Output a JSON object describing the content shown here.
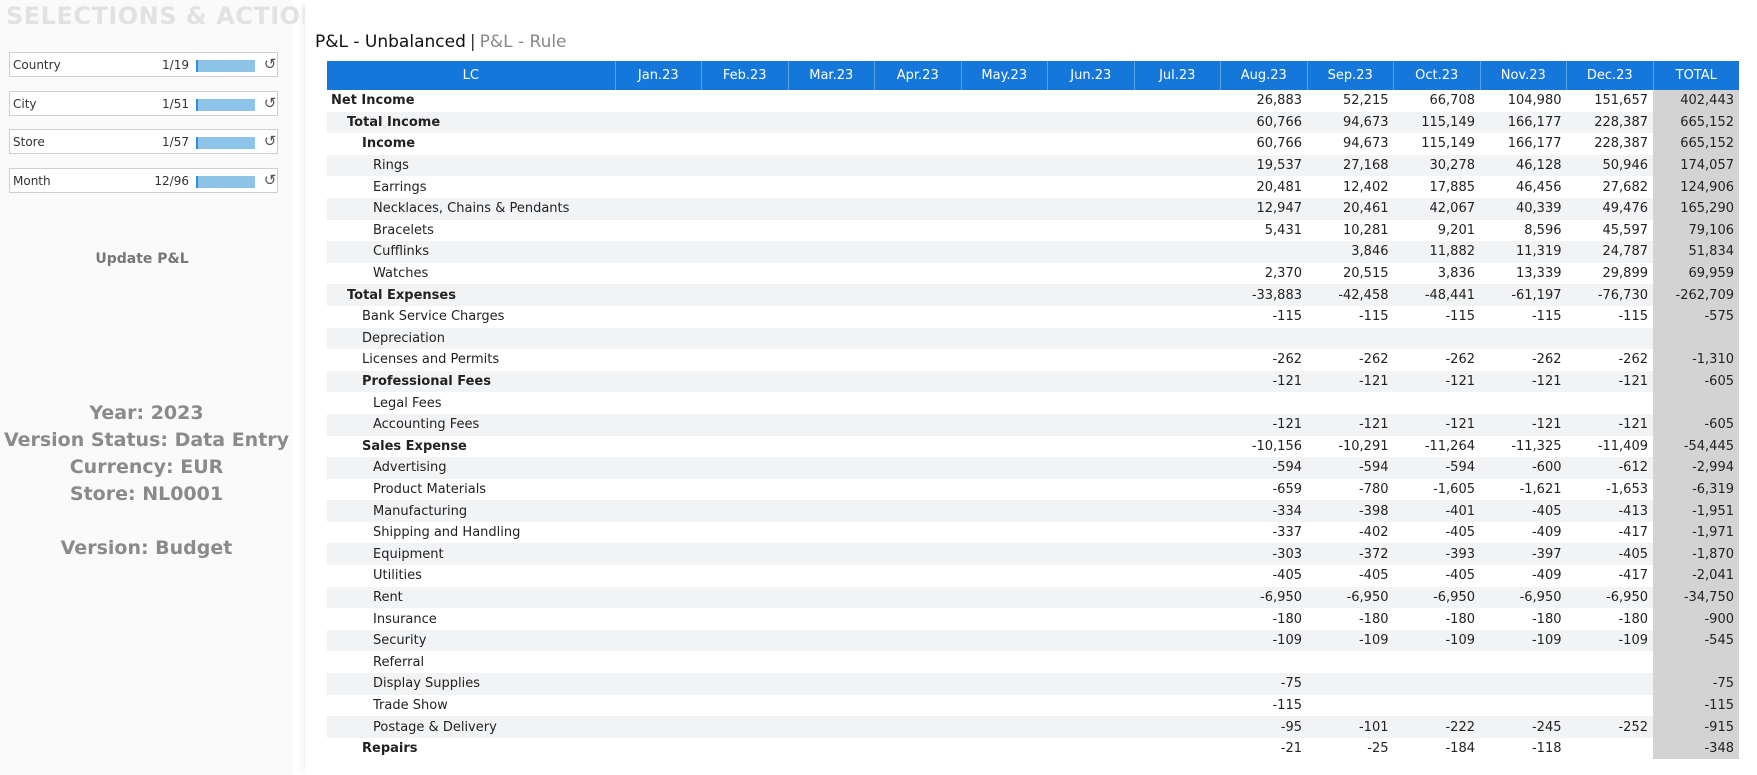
{
  "left": {
    "title": "SELECTIONS & ACTIONS",
    "selectors": [
      {
        "label": "Country",
        "count": "1/19"
      },
      {
        "label": "City",
        "count": "1/51"
      },
      {
        "label": "Store",
        "count": "1/57"
      },
      {
        "label": "Month",
        "count": "12/96"
      }
    ],
    "update_label": "Update P&L",
    "info": {
      "year": "Year: 2023",
      "version_status": "Version Status: Data Entry",
      "currency": "Currency: EUR",
      "store": "Store: NL0001",
      "version": "Version: Budget"
    }
  },
  "report": {
    "title_main": "P&L - Unbalanced",
    "title_sep": "|",
    "title_sub": "P&L - Rule",
    "columns": [
      "LC",
      "Jan.23",
      "Feb.23",
      "Mar.23",
      "Apr.23",
      "May.23",
      "Jun.23",
      "Jul.23",
      "Aug.23",
      "Sep.23",
      "Oct.23",
      "Nov.23",
      "Dec.23",
      "TOTAL"
    ],
    "rows": [
      {
        "label": "Net Income",
        "level": 0,
        "bold": true,
        "values": [
          "",
          "",
          "",
          "",
          "",
          "",
          "",
          "26,883",
          "52,215",
          "66,708",
          "104,980",
          "151,657",
          "402,443"
        ]
      },
      {
        "label": "Total Income",
        "level": 1,
        "bold": true,
        "values": [
          "",
          "",
          "",
          "",
          "",
          "",
          "",
          "60,766",
          "94,673",
          "115,149",
          "166,177",
          "228,387",
          "665,152"
        ]
      },
      {
        "label": "Income",
        "level": 2,
        "bold": true,
        "values": [
          "",
          "",
          "",
          "",
          "",
          "",
          "",
          "60,766",
          "94,673",
          "115,149",
          "166,177",
          "228,387",
          "665,152"
        ]
      },
      {
        "label": "Rings",
        "level": 3,
        "bold": false,
        "values": [
          "",
          "",
          "",
          "",
          "",
          "",
          "",
          "19,537",
          "27,168",
          "30,278",
          "46,128",
          "50,946",
          "174,057"
        ]
      },
      {
        "label": "Earrings",
        "level": 3,
        "bold": false,
        "values": [
          "",
          "",
          "",
          "",
          "",
          "",
          "",
          "20,481",
          "12,402",
          "17,885",
          "46,456",
          "27,682",
          "124,906"
        ]
      },
      {
        "label": "Necklaces, Chains & Pendants",
        "level": 3,
        "bold": false,
        "values": [
          "",
          "",
          "",
          "",
          "",
          "",
          "",
          "12,947",
          "20,461",
          "42,067",
          "40,339",
          "49,476",
          "165,290"
        ]
      },
      {
        "label": "Bracelets",
        "level": 3,
        "bold": false,
        "values": [
          "",
          "",
          "",
          "",
          "",
          "",
          "",
          "5,431",
          "10,281",
          "9,201",
          "8,596",
          "45,597",
          "79,106"
        ]
      },
      {
        "label": "Cufflinks",
        "level": 3,
        "bold": false,
        "values": [
          "",
          "",
          "",
          "",
          "",
          "",
          "",
          "",
          "3,846",
          "11,882",
          "11,319",
          "24,787",
          "51,834"
        ]
      },
      {
        "label": "Watches",
        "level": 3,
        "bold": false,
        "values": [
          "",
          "",
          "",
          "",
          "",
          "",
          "",
          "2,370",
          "20,515",
          "3,836",
          "13,339",
          "29,899",
          "69,959"
        ]
      },
      {
        "label": "Total Expenses",
        "level": 1,
        "bold": true,
        "values": [
          "",
          "",
          "",
          "",
          "",
          "",
          "",
          "-33,883",
          "-42,458",
          "-48,441",
          "-61,197",
          "-76,730",
          "-262,709"
        ]
      },
      {
        "label": "Bank Service Charges",
        "level": 2,
        "bold": false,
        "values": [
          "",
          "",
          "",
          "",
          "",
          "",
          "",
          "-115",
          "-115",
          "-115",
          "-115",
          "-115",
          "-575"
        ]
      },
      {
        "label": "Depreciation",
        "level": 2,
        "bold": false,
        "values": [
          "",
          "",
          "",
          "",
          "",
          "",
          "",
          "",
          "",
          "",
          "",
          "",
          ""
        ]
      },
      {
        "label": "Licenses and Permits",
        "level": 2,
        "bold": false,
        "values": [
          "",
          "",
          "",
          "",
          "",
          "",
          "",
          "-262",
          "-262",
          "-262",
          "-262",
          "-262",
          "-1,310"
        ]
      },
      {
        "label": "Professional Fees",
        "level": 2,
        "bold": true,
        "values": [
          "",
          "",
          "",
          "",
          "",
          "",
          "",
          "-121",
          "-121",
          "-121",
          "-121",
          "-121",
          "-605"
        ]
      },
      {
        "label": "Legal Fees",
        "level": 3,
        "bold": false,
        "values": [
          "",
          "",
          "",
          "",
          "",
          "",
          "",
          "",
          "",
          "",
          "",
          "",
          ""
        ]
      },
      {
        "label": "Accounting Fees",
        "level": 3,
        "bold": false,
        "values": [
          "",
          "",
          "",
          "",
          "",
          "",
          "",
          "-121",
          "-121",
          "-121",
          "-121",
          "-121",
          "-605"
        ]
      },
      {
        "label": "Sales Expense",
        "level": 2,
        "bold": true,
        "values": [
          "",
          "",
          "",
          "",
          "",
          "",
          "",
          "-10,156",
          "-10,291",
          "-11,264",
          "-11,325",
          "-11,409",
          "-54,445"
        ]
      },
      {
        "label": "Advertising",
        "level": 3,
        "bold": false,
        "values": [
          "",
          "",
          "",
          "",
          "",
          "",
          "",
          "-594",
          "-594",
          "-594",
          "-600",
          "-612",
          "-2,994"
        ]
      },
      {
        "label": "Product Materials",
        "level": 3,
        "bold": false,
        "values": [
          "",
          "",
          "",
          "",
          "",
          "",
          "",
          "-659",
          "-780",
          "-1,605",
          "-1,621",
          "-1,653",
          "-6,319"
        ]
      },
      {
        "label": "Manufacturing",
        "level": 3,
        "bold": false,
        "values": [
          "",
          "",
          "",
          "",
          "",
          "",
          "",
          "-334",
          "-398",
          "-401",
          "-405",
          "-413",
          "-1,951"
        ]
      },
      {
        "label": "Shipping and Handling",
        "level": 3,
        "bold": false,
        "values": [
          "",
          "",
          "",
          "",
          "",
          "",
          "",
          "-337",
          "-402",
          "-405",
          "-409",
          "-417",
          "-1,971"
        ]
      },
      {
        "label": "Equipment",
        "level": 3,
        "bold": false,
        "values": [
          "",
          "",
          "",
          "",
          "",
          "",
          "",
          "-303",
          "-372",
          "-393",
          "-397",
          "-405",
          "-1,870"
        ]
      },
      {
        "label": "Utilities",
        "level": 3,
        "bold": false,
        "values": [
          "",
          "",
          "",
          "",
          "",
          "",
          "",
          "-405",
          "-405",
          "-405",
          "-409",
          "-417",
          "-2,041"
        ]
      },
      {
        "label": "Rent",
        "level": 3,
        "bold": false,
        "values": [
          "",
          "",
          "",
          "",
          "",
          "",
          "",
          "-6,950",
          "-6,950",
          "-6,950",
          "-6,950",
          "-6,950",
          "-34,750"
        ]
      },
      {
        "label": "Insurance",
        "level": 3,
        "bold": false,
        "values": [
          "",
          "",
          "",
          "",
          "",
          "",
          "",
          "-180",
          "-180",
          "-180",
          "-180",
          "-180",
          "-900"
        ]
      },
      {
        "label": "Security",
        "level": 3,
        "bold": false,
        "values": [
          "",
          "",
          "",
          "",
          "",
          "",
          "",
          "-109",
          "-109",
          "-109",
          "-109",
          "-109",
          "-545"
        ]
      },
      {
        "label": "Referral",
        "level": 3,
        "bold": false,
        "values": [
          "",
          "",
          "",
          "",
          "",
          "",
          "",
          "",
          "",
          "",
          "",
          "",
          ""
        ]
      },
      {
        "label": "Display Supplies",
        "level": 3,
        "bold": false,
        "values": [
          "",
          "",
          "",
          "",
          "",
          "",
          "",
          "-75",
          "",
          "",
          "",
          "",
          "-75"
        ]
      },
      {
        "label": "Trade Show",
        "level": 3,
        "bold": false,
        "values": [
          "",
          "",
          "",
          "",
          "",
          "",
          "",
          "-115",
          "",
          "",
          "",
          "",
          "-115"
        ]
      },
      {
        "label": "Postage & Delivery",
        "level": 3,
        "bold": false,
        "values": [
          "",
          "",
          "",
          "",
          "",
          "",
          "",
          "-95",
          "-101",
          "-222",
          "-245",
          "-252",
          "-915"
        ]
      },
      {
        "label": "Repairs",
        "level": 2,
        "bold": true,
        "values": [
          "",
          "",
          "",
          "",
          "",
          "",
          "",
          "-21",
          "-25",
          "-184",
          "-118",
          "",
          "-348"
        ]
      }
    ]
  }
}
